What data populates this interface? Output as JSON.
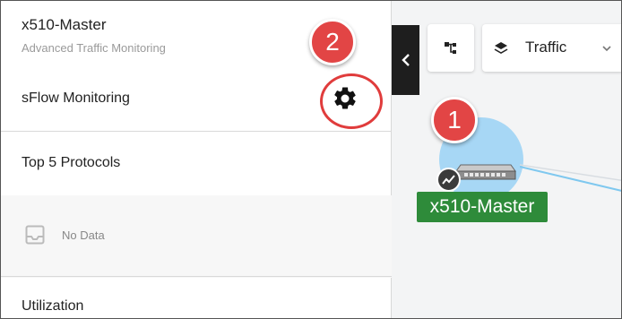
{
  "panel": {
    "device_name": "x510-Master",
    "device_subtitle": "Advanced Traffic Monitoring",
    "section_title": "sFlow Monitoring",
    "settings_icon": "gear-icon",
    "protocols_title": "Top 5 Protocols",
    "no_data_text": "No Data",
    "no_data_icon": "inbox-icon",
    "utilization_title": "Utilization"
  },
  "map": {
    "topology_icon": "topology-icon",
    "view_dropdown_label": "Traffic",
    "view_dropdown_icon": "layers-icon",
    "node_label": "x510-Master",
    "node_icon": "switch-icon",
    "node_badge_icon": "activity-icon"
  },
  "callouts": {
    "first": "1",
    "second": "2"
  },
  "colors": {
    "callout": "#e24545",
    "node_label_bg": "#2e8b3a",
    "node_halo": "#a7d7f5",
    "collapse_handle": "#1e1e1e"
  }
}
